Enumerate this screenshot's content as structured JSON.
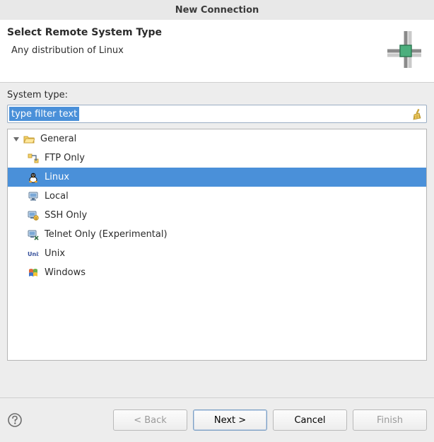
{
  "window": {
    "title": "New Connection"
  },
  "banner": {
    "heading": "Select Remote System Type",
    "description": "Any distribution of Linux"
  },
  "body": {
    "system_type_label": "System type:",
    "filter_placeholder": "type filter text"
  },
  "tree": {
    "group_label": "General",
    "group_expanded": true,
    "selected_id": "linux",
    "items": [
      {
        "id": "ftp",
        "label": "FTP Only",
        "icon": "ftp-icon"
      },
      {
        "id": "linux",
        "label": "Linux",
        "icon": "linux-icon"
      },
      {
        "id": "local",
        "label": "Local",
        "icon": "local-icon"
      },
      {
        "id": "ssh",
        "label": "SSH Only",
        "icon": "ssh-icon"
      },
      {
        "id": "telnet",
        "label": "Telnet Only (Experimental)",
        "icon": "telnet-icon"
      },
      {
        "id": "unix",
        "label": "Unix",
        "icon": "unix-icon"
      },
      {
        "id": "windows",
        "label": "Windows",
        "icon": "windows-icon"
      }
    ]
  },
  "buttons": {
    "back": "< Back",
    "next": "Next >",
    "cancel": "Cancel",
    "finish": "Finish"
  },
  "colors": {
    "selection": "#4a90d9",
    "border": "#b5b5b5"
  }
}
